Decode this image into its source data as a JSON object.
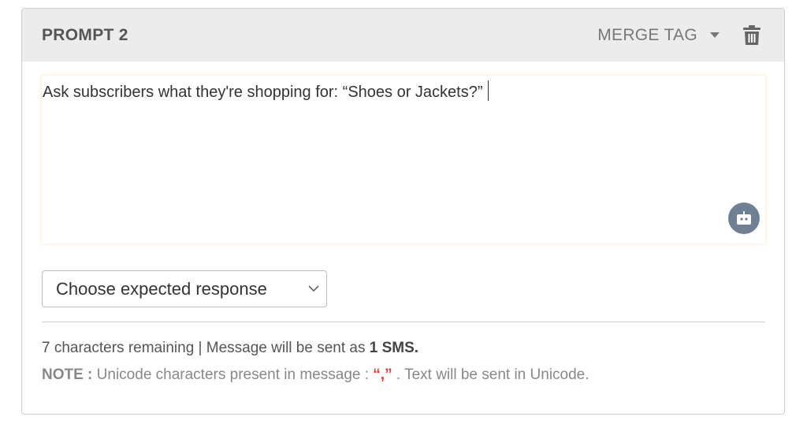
{
  "header": {
    "title": "PROMPT 2",
    "merge_tag_label": "MERGE TAG"
  },
  "editor": {
    "text": "Ask subscribers what they're shopping for: “Shoes or Jackets?”"
  },
  "response_select": {
    "selected": "Choose expected response"
  },
  "footer": {
    "remaining_text": "7 characters remaining | Message will be sent as ",
    "sms_count": "1 SMS.",
    "note_label": "NOTE :",
    "note_text": " Unicode characters present in message : ",
    "unicode_chars": "“,”",
    "note_suffix": " . Text will be sent in Unicode."
  },
  "icons": {
    "trash": "trash-icon",
    "caret": "caret-down-icon",
    "bot": "robot-icon",
    "select_chevron": "chevron-down-icon"
  },
  "colors": {
    "header_bg": "#ececec",
    "bot_button": "#6f7f94",
    "unicode_highlight": "#e53935"
  }
}
